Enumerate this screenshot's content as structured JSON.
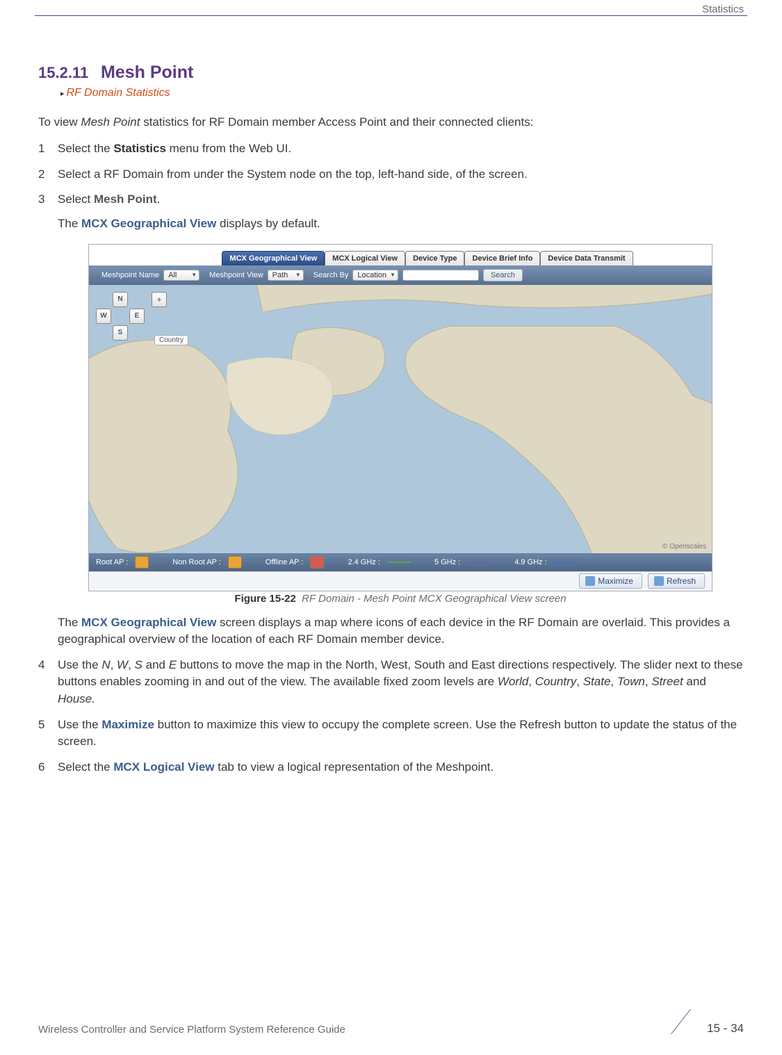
{
  "header": {
    "section": "Statistics"
  },
  "section": {
    "number": "15.2.11",
    "title": "Mesh Point",
    "breadcrumb": "RF Domain Statistics"
  },
  "intro": {
    "prefix": "To view ",
    "italic": "Mesh Point",
    "suffix": " statistics for RF Domain member Access Point and their connected clients:"
  },
  "steps": [
    {
      "num": "1",
      "parts": [
        {
          "t": "Select the "
        },
        {
          "t": "Statistics",
          "cls": "bold-dark"
        },
        {
          "t": " menu from the Web UI."
        }
      ]
    },
    {
      "num": "2",
      "parts": [
        {
          "t": "Select a RF Domain from under the System node on the top, left-hand side, of the screen."
        }
      ]
    },
    {
      "num": "3",
      "parts": [
        {
          "t": "Select "
        },
        {
          "t": "Mesh Point",
          "cls": "bold-gray"
        },
        {
          "t": "."
        }
      ],
      "sub": [
        {
          "t": "The "
        },
        {
          "t": "MCX Geographical View",
          "cls": "bold-blue"
        },
        {
          "t": " displays by default."
        }
      ]
    }
  ],
  "figure": {
    "tabs": [
      {
        "label": "MCX Geographical View",
        "active": true
      },
      {
        "label": "MCX Logical View"
      },
      {
        "label": "Device Type"
      },
      {
        "label": "Device Brief Info"
      },
      {
        "label": "Device Data Transmit"
      }
    ],
    "toolbar": {
      "meshpointNameLabel": "Meshpoint Name",
      "meshpointNameValue": "All",
      "meshpointViewLabel": "Meshpoint View",
      "meshpointViewValue": "Path",
      "searchByLabel": "Search By",
      "searchByValue": "Location",
      "searchBtn": "Search"
    },
    "compass": {
      "n": "N",
      "w": "W",
      "s": "S",
      "e": "E",
      "plus": "+"
    },
    "zoomLabel": "Country",
    "attribution": "© Openscales",
    "legend": {
      "rootAp": "Root AP :",
      "nonRootAp": "Non Root AP :",
      "offlineAp": "Offline AP :",
      "g24": "2.4 GHz :",
      "g5": "5 GHz :",
      "g49": "4.9 GHz :"
    },
    "buttons": {
      "maximize": "Maximize",
      "refresh": "Refresh"
    },
    "caption": {
      "label": "Figure 15-22",
      "text": "RF Domain - Mesh Point MCX Geographical View screen"
    }
  },
  "poststeps": [
    {
      "sub": true,
      "parts": [
        {
          "t": "The "
        },
        {
          "t": "MCX Geographical View",
          "cls": "bold-blue"
        },
        {
          "t": " screen displays a map where icons of each device in the RF Domain are overlaid. This provides a geographical overview of the location of each RF Domain member device."
        }
      ]
    },
    {
      "num": "4",
      "parts": [
        {
          "t": "Use the "
        },
        {
          "t": "N",
          "cls": "italic"
        },
        {
          "t": ", "
        },
        {
          "t": "W",
          "cls": "italic"
        },
        {
          "t": ", "
        },
        {
          "t": "S",
          "cls": "italic"
        },
        {
          "t": " and "
        },
        {
          "t": "E",
          "cls": "italic"
        },
        {
          "t": " buttons to move the map in the North, West, South and East directions respectively. The slider next to these buttons enables zooming in and out of the view. The available fixed zoom levels are "
        },
        {
          "t": "World",
          "cls": "italic"
        },
        {
          "t": ", "
        },
        {
          "t": "Country",
          "cls": "italic"
        },
        {
          "t": ", "
        },
        {
          "t": "State",
          "cls": "italic"
        },
        {
          "t": ", "
        },
        {
          "t": "Town",
          "cls": "italic"
        },
        {
          "t": ", "
        },
        {
          "t": "Street",
          "cls": "italic"
        },
        {
          "t": " and "
        },
        {
          "t": "House.",
          "cls": "italic"
        }
      ]
    },
    {
      "num": "5",
      "parts": [
        {
          "t": "Use the "
        },
        {
          "t": "Maximize",
          "cls": "bold-blue"
        },
        {
          "t": " button to maximize this view to occupy the complete screen. Use the Refresh button to update the status of the screen."
        }
      ]
    },
    {
      "num": "6",
      "parts": [
        {
          "t": "Select the "
        },
        {
          "t": "MCX Logical View",
          "cls": "bold-blue"
        },
        {
          "t": " tab to view a logical representation of the Meshpoint."
        }
      ]
    }
  ],
  "footer": {
    "left": "Wireless Controller and Service Platform System Reference Guide",
    "page": "15 - 34"
  }
}
